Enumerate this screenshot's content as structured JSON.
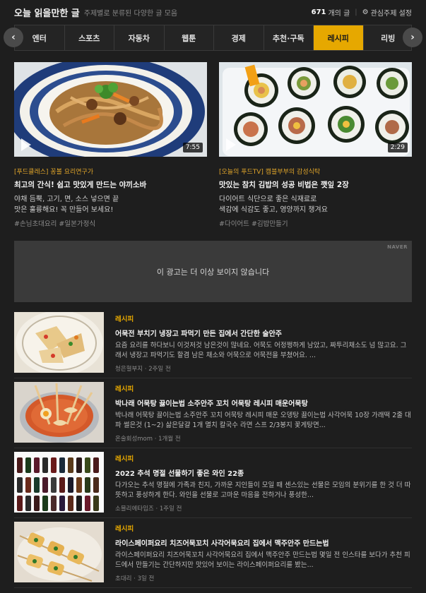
{
  "header": {
    "title": "오늘 읽을만한 글",
    "subtitle": "주제별로 분류된 다양한 글 모음",
    "count": "671",
    "count_suffix": "개의 글",
    "settings_label": "관심주제 설정"
  },
  "tabs": [
    {
      "label": "엔터"
    },
    {
      "label": "스포츠"
    },
    {
      "label": "자동차"
    },
    {
      "label": "웹툰"
    },
    {
      "label": "경제"
    },
    {
      "label": "추천·구독"
    },
    {
      "label": "레시피"
    },
    {
      "label": "리빙"
    }
  ],
  "active_tab": "레시피",
  "colors": {
    "accent": "#e6a800",
    "background": "#1e1e1e",
    "source": "#e0a52a"
  },
  "video_cards": [
    {
      "source": "[푸드클레스] 꽁볼 요리연구가",
      "title": "최고의 간식! 쉽고 맛있게 만드는 야끼소바",
      "desc_line1": "야채 듬뿍, 고기, 면, 소스 넣으면 끝",
      "desc_line2": "맛은 훌륭해요! 꼭 만들어 보세요!",
      "tags": "#손님초대요리 #일본가정식",
      "duration": "7:55",
      "icon": "play-icon"
    },
    {
      "source": "[오늘의 푸드TV] 캠블부부의 감성식탁",
      "title": "맛있는 참치 김밥의 성공 비법은 깻잎 2장",
      "desc_line1": "다이어트 식단으로 좋은 식재료로",
      "desc_line2": "색감에 식감도 좋고, 영양까지 챙겨요",
      "tags": "#다이어트 #김밥만들기",
      "duration": "2:29",
      "icon": "play-icon"
    }
  ],
  "ad": {
    "text": "이 광고는 더 이상 보이지 않습니다",
    "brand": "NAVER"
  },
  "articles": [
    {
      "category": "레시피",
      "title": "어묵전 부치기 냉장고 파먹기 만든 집에서 간단한 술안주",
      "summary": "요즘 요리를 하다보니 이것저것 남은것이 많네요. 어묵도 어정쩡하게 남았고, 짜투리채소도 넘 많고요. 그래서 냉장고 파먹기도 할겸 남은 채소와 어묵으로 어묵전을 부쳤어요. ...",
      "meta": "청은혈부지 · 2주일 전"
    },
    {
      "category": "레시피",
      "title": "박나래 어묵탕 끓이는법 소주안주 꼬치 어묵탕 레시피 매운어묵탕",
      "summary": "박나래 어묵탕 끓이는법 소주안주 꼬치 어묵탕 레시피 매운 오뎅탕 끓이는법 사각어묵 10장 가래떡 2줄 대파 썰은것 (1~2) 삶은달걀 1개 멸치 칼국수 라면 스프 2/3봉지 꽃게탕면...",
      "meta": "온술회성mom · 1개월 전"
    },
    {
      "category": "레시피",
      "title": "2022 추석 명절 선물하기 좋은 와인 22종",
      "summary": "다가오는 추석 명절에 가족과 친지, 가까운 지인들이 모일 때 센스있는 선물은 모임의 분위기를 한 것 더 따뜻하고 풍성하게 한다. 와인을 선물로 고마운 마음을 전하거나 풍성한...",
      "meta": "소믈리에타임즈 · 1주일 전"
    },
    {
      "category": "레시피",
      "title": "라이스페이퍼요리 치즈어묵꼬치 사각어묵요리 집에서 맥주안주 만드는법",
      "summary": "라이스페이퍼요리 치즈어묵꼬치 사각어묵요리 집에서 맥주안주 만드는법 몇일 전 인스타를 보다가 추천 피드에서 만들기는 간단하지만 맛있어 보이는 라이스페이퍼요리를 봤는...",
      "meta": "초대리 · 3일 전"
    }
  ]
}
